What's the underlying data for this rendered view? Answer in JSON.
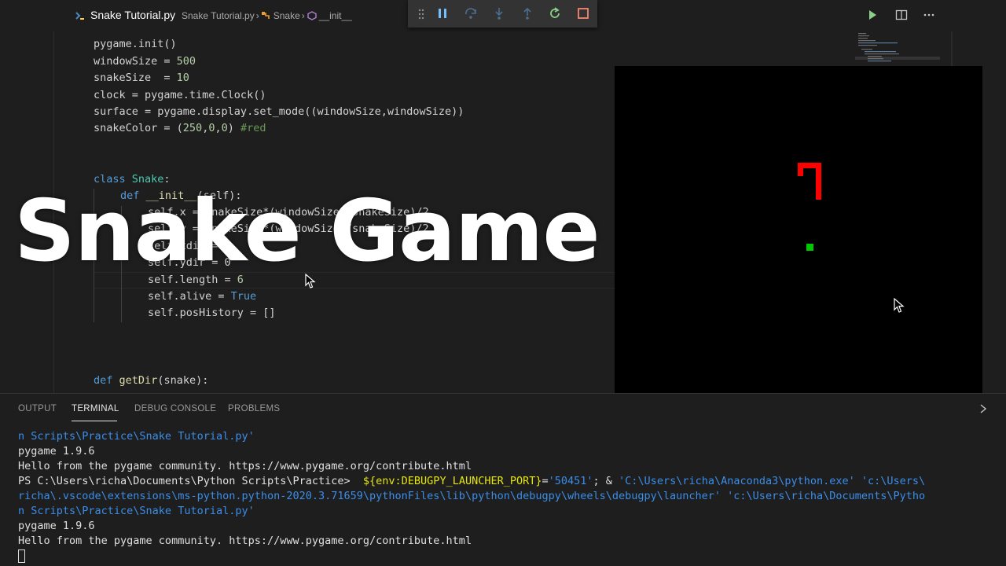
{
  "colors": {
    "background": "#1e1e1e",
    "snake": "#ff0000",
    "food": "#00c800",
    "game_background": "#000000"
  },
  "tab": {
    "title": "Snake Tutorial.py",
    "icon": "python-file-icon"
  },
  "breadcrumb": {
    "file": "Snake Tutorial.py",
    "sep1": " › ",
    "class_name": "Snake",
    "sep2": " › ",
    "method": "__init__"
  },
  "debug_toolbar": [
    "grip-icon",
    "pause-icon",
    "step-over-icon",
    "step-into-icon",
    "step-out-icon",
    "restart-icon",
    "stop-icon"
  ],
  "right_actions": [
    "run-icon",
    "split-editor-icon",
    "more-actions-icon"
  ],
  "code": {
    "l1": "pygame.init()",
    "l2a": "windowSize = ",
    "l2b": "500",
    "l3a": "snakeSize  = ",
    "l3b": "10",
    "l4": "clock = pygame.time.Clock()",
    "l5": "surface = pygame.display.set_mode((windowSize,windowSize))",
    "l6a": "snakeColor = (",
    "l6b": "250",
    "l6c": ",",
    "l6d": "0",
    "l6e": ",",
    "l6f": "0",
    "l6g": ") ",
    "l6h": "#red",
    "l7a": "class",
    "l7b": " ",
    "l7c": "Snake",
    "l7d": ":",
    "l8a": "def",
    "l8b": " ",
    "l8c": "__init__",
    "l8d": "(self):",
    "l9": "self.x = snakeSize*(windowSize//snakeSize)/2",
    "l10": "self.y = snakeSize*(windowSize//snakeSize)/2",
    "l11": "self.xdir = 1",
    "l12": "self.ydir = 0",
    "l13a": "self.length = ",
    "l13b": "6",
    "l14a": "self.alive = ",
    "l14b": "True",
    "l15": "self.posHistory = []",
    "l16a": "def",
    "l16b": " ",
    "l16c": "getDir",
    "l16d": "(snake):"
  },
  "overlay_title": "Snake Game",
  "game": {
    "snake": "snake-red",
    "food": "food-green"
  },
  "panel": {
    "tabs": [
      "OUTPUT",
      "TERMINAL",
      "DEBUG CONSOLE",
      "PROBLEMS"
    ],
    "active_tab": "TERMINAL"
  },
  "terminal": {
    "t1": "n Scripts\\Practice\\Snake Tutorial.py'",
    "t2": "pygame 1.9.6",
    "t3": "Hello from the pygame community. https://www.pygame.org/contribute.html",
    "t4a": "PS C:\\Users\\richa\\Documents\\Python Scripts\\Practice>  ",
    "t4b": "${env:DEBUGPY_LAUNCHER_PORT}",
    "t4c": "=",
    "t4d": "'50451'",
    "t4e": "; & ",
    "t4f": "'C:\\Users\\richa\\Anaconda3\\python.exe' 'c:\\Users\\",
    "t5": "richa\\.vscode\\extensions\\ms-python.python-2020.3.71659\\pythonFiles\\lib\\python\\debugpy\\wheels\\debugpy\\launcher' 'c:\\Users\\richa\\Documents\\Pytho",
    "t6": "n Scripts\\Practice\\Snake Tutorial.py'",
    "t7": "pygame 1.9.6",
    "t8": "Hello from the pygame community. https://www.pygame.org/contribute.html"
  }
}
